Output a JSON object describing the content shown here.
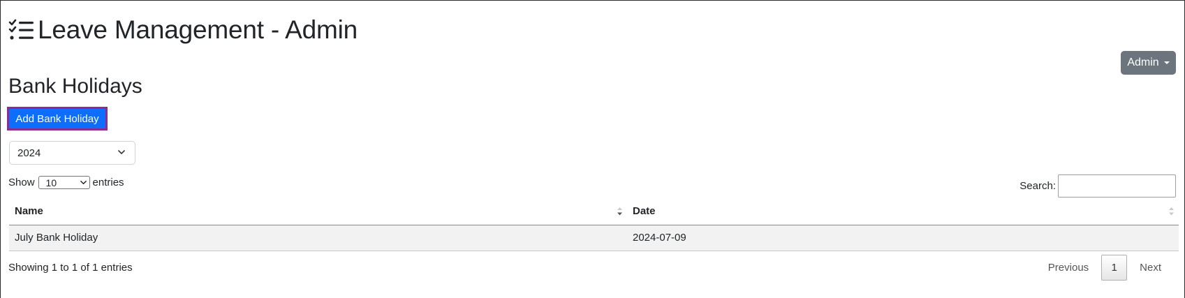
{
  "header": {
    "title": "Leave Management - Admin",
    "icon": "task-list-icon"
  },
  "user_menu": {
    "label": "Admin",
    "icon": "caret-down-icon"
  },
  "page": {
    "title": "Bank Holidays"
  },
  "actions": {
    "add_label": "Add Bank Holiday"
  },
  "year_filter": {
    "value": "2024"
  },
  "table_controls": {
    "show_label": "Show",
    "length_value": "10",
    "entries_label": "entries",
    "search_label": "Search:",
    "search_value": ""
  },
  "table": {
    "columns": [
      "Name",
      "Date"
    ],
    "rows": [
      {
        "name": "July Bank Holiday",
        "date": "2024-07-09"
      }
    ]
  },
  "footer": {
    "info": "Showing 1 to 1 of 1 entries",
    "previous": "Previous",
    "current_page": "1",
    "next": "Next"
  },
  "colors": {
    "primary": "#0d6efd",
    "secondary": "#6c757d",
    "focus_outline": "#8e2b8e",
    "row_stripe": "#f2f2f2"
  }
}
